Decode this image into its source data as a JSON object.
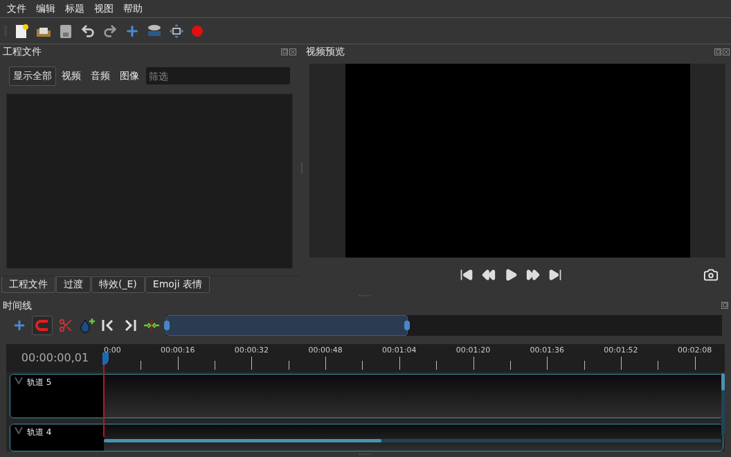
{
  "menu": [
    "文件",
    "编辑",
    "标题",
    "视图",
    "帮助"
  ],
  "project_files": {
    "title": "工程文件",
    "filters": [
      {
        "label": "显示全部",
        "selected": true
      },
      {
        "label": "视频",
        "selected": false
      },
      {
        "label": "音频",
        "selected": false
      },
      {
        "label": "图像",
        "selected": false
      }
    ],
    "filter_field": {
      "placeholder": "筛选"
    }
  },
  "bottom_tabs": [
    {
      "label": "工程文件",
      "selected": true
    },
    {
      "label": "过渡",
      "selected": false
    },
    {
      "label": "特效(_E)",
      "selected": false
    },
    {
      "label": "Emoji 表情",
      "selected": false
    }
  ],
  "video_preview": {
    "title": "视频预览"
  },
  "timeline": {
    "title": "时间线",
    "snapping_on": true,
    "timecode": "00:00:00,01",
    "ruler_labels": [
      "0:00",
      "00:00:16",
      "00:00:32",
      "00:00:48",
      "00:01:04",
      "00:01:20",
      "00:01:36",
      "00:01:52",
      "00:02:08"
    ],
    "tracks": [
      {
        "name": "轨道 5"
      },
      {
        "name": "轨道 4"
      }
    ]
  }
}
